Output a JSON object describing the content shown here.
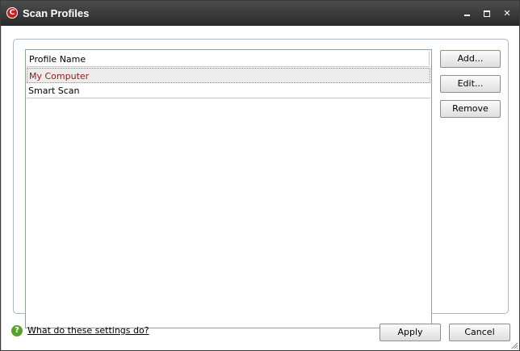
{
  "window": {
    "title": "Scan Profiles",
    "app_icon_glyph": "C"
  },
  "title_controls": {
    "close_glyph": "✕"
  },
  "list": {
    "column_header": "Profile Name",
    "rows": [
      "My Computer",
      "Smart Scan"
    ],
    "selected_index": 0
  },
  "side_buttons": {
    "add": "Add...",
    "edit": "Edit...",
    "remove": "Remove"
  },
  "footer": {
    "help_glyph": "?",
    "help_link": "What do these settings do?",
    "apply": "Apply",
    "cancel": "Cancel"
  },
  "colors": {
    "titlebar": "#2a2a2a",
    "selected_text": "#8b1a1a",
    "help_icon": "#5aa02c",
    "app_icon": "#c8201f"
  },
  "icons": [
    "app-logo-icon",
    "minimize-icon",
    "maximize-icon",
    "close-icon",
    "help-icon",
    "resize-grip-icon"
  ]
}
